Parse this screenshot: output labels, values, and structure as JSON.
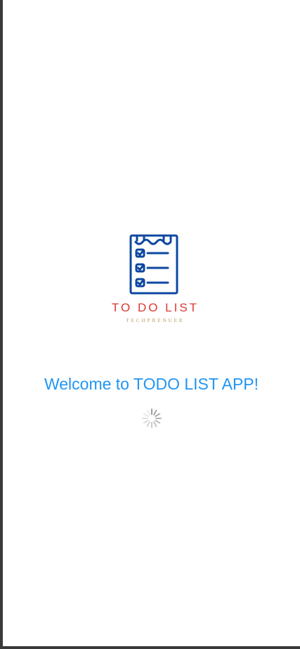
{
  "logo": {
    "icon": "todo-clipboard-icon",
    "title": "TO DO LIST",
    "subtitle": "TECHPRENUER"
  },
  "welcome_text": "Welcome to TODO LIST APP!",
  "loading_indicator": "spinner-icon",
  "colors": {
    "brand_blue": "#0d47a1",
    "logo_red": "#d83a34",
    "logo_gold": "#b59b62",
    "welcome_blue": "#2196f3",
    "spinner_gray": "#9e9e9e"
  }
}
